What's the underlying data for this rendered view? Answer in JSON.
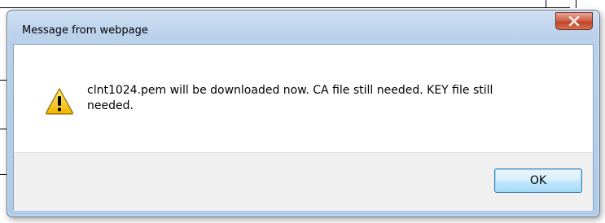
{
  "dialog": {
    "title": "Message from webpage",
    "close_icon": "close-icon",
    "message": "clnt1024.pem will be downloaded now. CA file still needed. KEY file still needed.",
    "message_line1": "clnt1024.pem will be downloaded now. CA file still needed. KEY file still",
    "message_line2": "needed.",
    "warning_icon": "warning-icon",
    "ok_label": "OK"
  },
  "colors": {
    "close_button": "#c2442a",
    "ok_button_border": "#3c7fb1",
    "titlebar": "#b9d1ea"
  }
}
